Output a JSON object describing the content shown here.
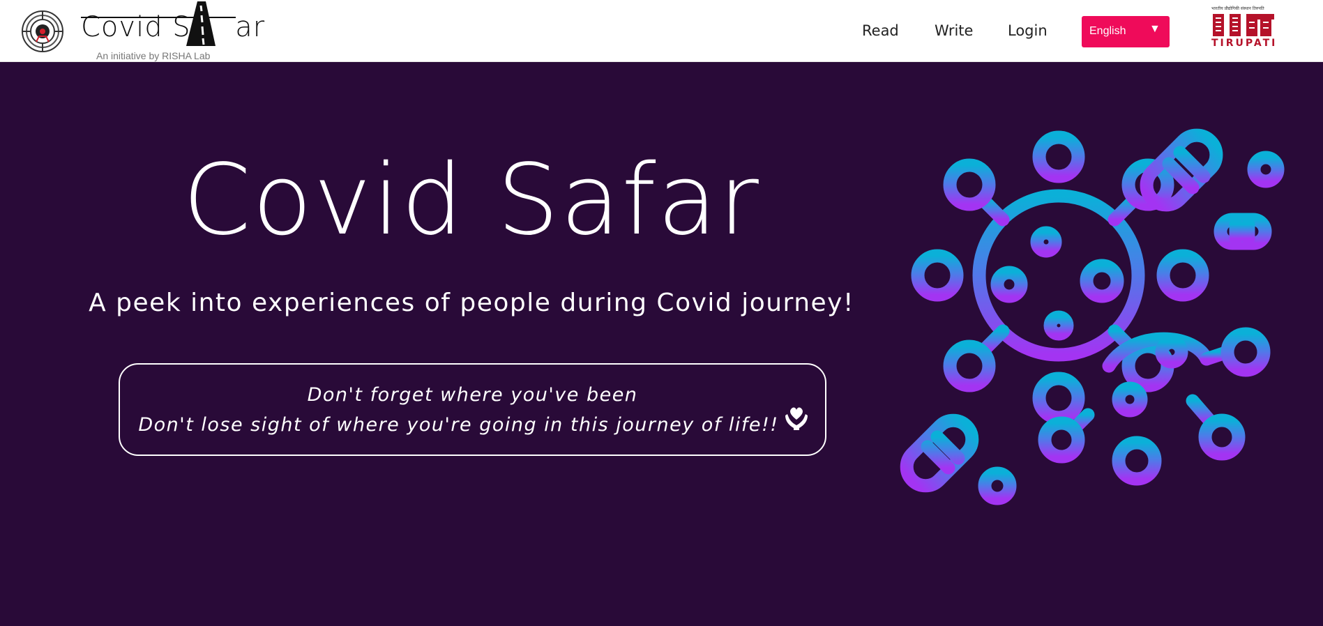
{
  "header": {
    "brand_title_left": "Covid Sa",
    "brand_title_right": "ar",
    "brand_subtitle": "An initiative by RISHA Lab",
    "nav": [
      {
        "label": "Read",
        "icon": ""
      },
      {
        "label": "Write",
        "icon": ""
      },
      {
        "label": "Login",
        "icon": ""
      }
    ],
    "language": {
      "selected": "English",
      "caret": "▼"
    },
    "partner_logo": {
      "top_text": "भारतीय प्रौद्योगिकी संस्थान तिरुपति",
      "name": "TIRUPATI"
    }
  },
  "hero": {
    "title": "Covid Safar",
    "subtitle": "A peek into experiences of people during Covid journey!",
    "quote_line1": "Don't forget where you've been",
    "quote_line2": "Don't lose sight of where you're going in this journey of life!!"
  },
  "colors": {
    "background": "#290a38",
    "accent": "#ef0b5a",
    "virus_gradient_top": "#0bb0d8",
    "virus_gradient_bottom": "#a334f2"
  },
  "icons": [
    "risha-logo-icon",
    "road-icon",
    "caret-down-icon",
    "iit-logo-icon",
    "caring-hands-heart-icon",
    "virus-illustration"
  ]
}
